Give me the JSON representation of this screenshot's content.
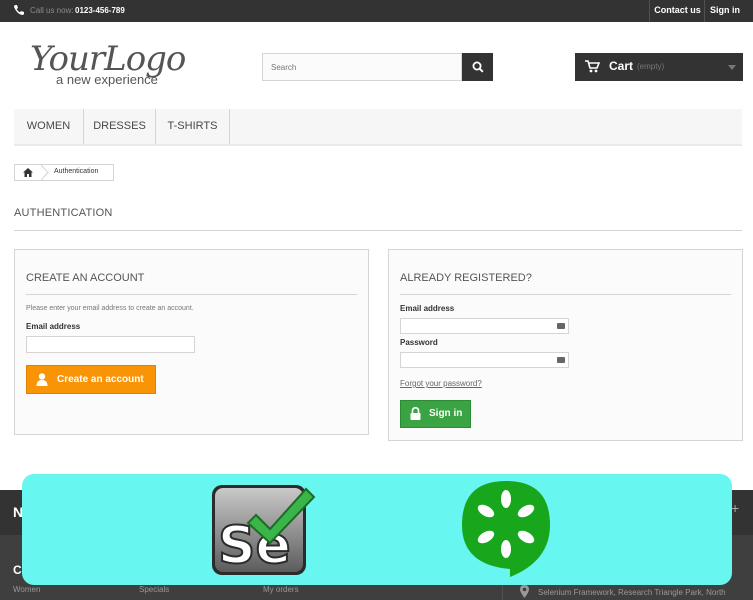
{
  "topbar": {
    "call_label": "Call us now:",
    "call_number": "0123-456-789",
    "contact_label": "Contact us",
    "signin_label": "Sign in"
  },
  "header": {
    "logo_main": "YourLogo",
    "logo_tagline": "a new experience",
    "search_placeholder": "Search",
    "cart_label": "Cart",
    "cart_status": "(empty)"
  },
  "menu": {
    "items": [
      "WOMEN",
      "DRESSES",
      "T-SHIRTS"
    ]
  },
  "breadcrumb": {
    "current": "Authentication"
  },
  "page": {
    "heading": "AUTHENTICATION"
  },
  "create_account": {
    "title": "CREATE AN ACCOUNT",
    "help": "Please enter your email address to create an account.",
    "email_label": "Email address",
    "email_value": "",
    "button_label": "Create an account"
  },
  "registered": {
    "title": "ALREADY REGISTERED?",
    "email_label": "Email address",
    "email_value": "",
    "password_label": "Password",
    "password_value": "",
    "forgot_label": "Forgot your password?",
    "button_label": "Sign in"
  },
  "footer": {
    "section_initial": "N",
    "plus": "+",
    "col_initial": "C",
    "links": [
      "Women",
      "Specials",
      "My orders"
    ],
    "address": "Selenium Framework, Research Triangle Park, North"
  },
  "colors": {
    "dark": "#333333",
    "orange_button": "#f89406",
    "green_button": "#3aa343",
    "overlay": "#68f7f0",
    "cucumber_green": "#18a61d"
  }
}
